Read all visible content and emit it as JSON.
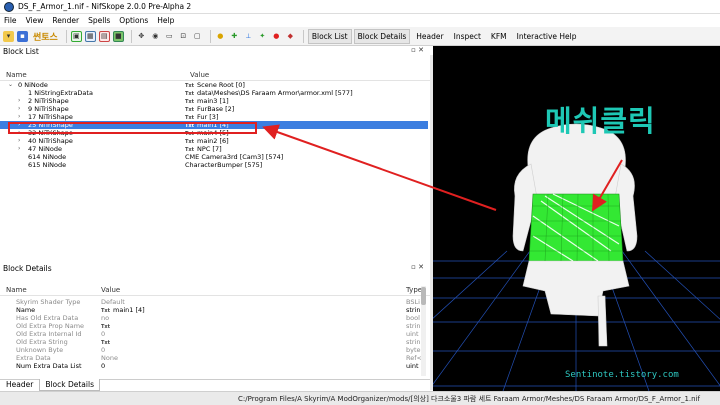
{
  "window": {
    "title": "DS_F_Armor_1.nif - NifSkope 2.0.0 Pre-Alpha 2"
  },
  "menu": [
    "File",
    "View",
    "Render",
    "Spells",
    "Options",
    "Help"
  ],
  "toolbar": {
    "logo": "썬토스",
    "tabs": [
      "Block List",
      "Block Details",
      "Header",
      "Inspect",
      "KFM",
      "Interactive Help"
    ],
    "active_tabs": [
      0,
      1
    ]
  },
  "block_list": {
    "title": "Block List",
    "col_name": "Name",
    "col_value": "Value",
    "rows": [
      {
        "chev": "⌄",
        "name": "0 NiNode",
        "badge": "Txt",
        "value": "Scene Root [0]",
        "indent": 0,
        "selected": false
      },
      {
        "chev": "",
        "name": "1 NiStringExtraData",
        "badge": "Txt",
        "value": "data\\Meshes\\DS Faraam Armor\\armor.xml [577]",
        "indent": 1,
        "selected": false
      },
      {
        "chev": "›",
        "name": "2 NiTriShape",
        "badge": "Txt",
        "value": "main3 [1]",
        "indent": 1,
        "selected": false
      },
      {
        "chev": "›",
        "name": "9 NiTriShape",
        "badge": "Txt",
        "value": "FurBase [2]",
        "indent": 1,
        "selected": false
      },
      {
        "chev": "›",
        "name": "17 NiTriShape",
        "badge": "Txt",
        "value": "Fur [3]",
        "indent": 1,
        "selected": false
      },
      {
        "chev": "›",
        "name": "25 NiTriShape",
        "badge": "Txt",
        "value": "main1 [4]",
        "indent": 1,
        "selected": true
      },
      {
        "chev": "›",
        "name": "32 NiTriShape",
        "badge": "Txt",
        "value": "main4 [5]",
        "indent": 1,
        "selected": false
      },
      {
        "chev": "›",
        "name": "40 NiTriShape",
        "badge": "Txt",
        "value": "main2 [6]",
        "indent": 1,
        "selected": false
      },
      {
        "chev": "›",
        "name": "47 NiNode",
        "badge": "Txt",
        "value": "NPC [7]",
        "indent": 1,
        "selected": false
      },
      {
        "chev": "",
        "name": "614 NiNode",
        "badge": "",
        "value": "CME Camera3rd [Cam3] [574]",
        "indent": 1,
        "selected": false
      },
      {
        "chev": "",
        "name": "615 NiNode",
        "badge": "",
        "value": "CharacterBumper [575]",
        "indent": 1,
        "selected": false
      }
    ]
  },
  "block_details": {
    "title": "Block Details",
    "col_name": "Name",
    "col_value": "Value",
    "col_type": "Type",
    "rows": [
      {
        "name": "Skyrim Shader Type",
        "badge": "",
        "value": "Default",
        "type": "BSLi",
        "grey": true
      },
      {
        "name": "Name",
        "badge": "Txt",
        "value": "main1 [4]",
        "type": "strin",
        "grey": false
      },
      {
        "name": "Has Old Extra Data",
        "badge": "",
        "value": "no",
        "type": "bool",
        "grey": true
      },
      {
        "name": "Old Extra Prop Name",
        "badge": "Txt",
        "value": "",
        "type": "strin",
        "grey": true
      },
      {
        "name": "Old Extra Internal Id",
        "badge": "",
        "value": "0",
        "type": "uint",
        "grey": true
      },
      {
        "name": "Old Extra String",
        "badge": "Txt",
        "value": "",
        "type": "strin",
        "grey": true
      },
      {
        "name": "Unknown Byte",
        "badge": "",
        "value": "0",
        "type": "byte",
        "grey": true
      },
      {
        "name": "Extra Data",
        "badge": "",
        "value": "None",
        "type": "Ref<",
        "grey": true
      },
      {
        "name": "Num Extra Data List",
        "badge": "",
        "value": "0",
        "type": "uint",
        "grey": false
      }
    ]
  },
  "bottom_tabs": [
    "Header",
    "Block Details"
  ],
  "status": {
    "path": "C:/Program Files/A Skyrim/A ModOrganizer/mods/[의상] 다크소울3 파람 세트 Faraam Armor/Meshes/DS Faraam Armor/DS_F_Armor_1.nif"
  },
  "viewport": {
    "callout": "메쉬클릭",
    "watermark": "Sentinote.tistory.com",
    "colors": {
      "callout": "#1ec8b5",
      "mesh_white": "#f2f2f2",
      "mesh_green": "#33e833",
      "grid": "#2a5fd8",
      "arrow": "#e02020"
    }
  },
  "icons": [
    "open-icon",
    "save-icon",
    "logo-icon",
    "block-icon",
    "grid-icon",
    "cube-icon",
    "orbit-icon",
    "eye-icon",
    "camera-icon",
    "fit-icon",
    "light-icon",
    "axes-icon",
    "node-icon",
    "pin-icon",
    "paint-icon"
  ]
}
